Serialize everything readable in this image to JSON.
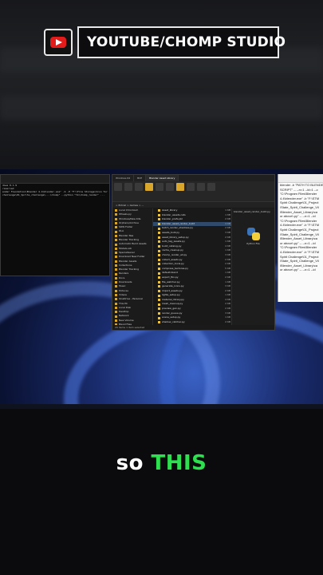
{
  "banner": {
    "text": "YOUTUBE/CHOMP STUDIO",
    "logo_icon": "youtube-play-icon",
    "accent": "#e21b1b"
  },
  "caption": {
    "word1": "so",
    "word2": "THIS",
    "highlight_color": "#2ee04f"
  },
  "terminal": {
    "lines": [
      "dows 0.1.9",
      "reserved",
      "",
      "ender Foundation\\Blender 4.4\\blender.exe\" -b -P \"F:\\File Storage\\Icon for Imported Blend Sp",
      "challenge\\01_Sprite_challenge\\...\\chomp\" --python \"tk\\chomp_render\" ...",
      "",
      "",
      ""
    ]
  },
  "explorer": {
    "tabs": [
      "Windows 64",
      "BCE",
      "Blender Asset Library"
    ],
    "address": "> Entrail > Games > ...",
    "nav": [
      "Local Chromium",
      "Wheels-py",
      "Windows/New Kits",
      "Orphans/Archive",
      "SOW Folder",
      "DLA",
      "Blender Nes",
      "Blender Tracking",
      "Automatic Build Assets",
      "Models-Lib",
      "SpecialGener",
      "Download New Folder",
      "Blender Assets",
      "Collections",
      "Blender Tracking",
      "Renders",
      "Docs",
      "Downloads",
      "Music",
      "Pictures",
      "Videos",
      "OneDrive - Personal",
      "This PC",
      "Local Disk",
      "Desktop",
      "Network",
      "New Volume",
      "Blend Files",
      "Game Build",
      "Assets",
      "Stored Files",
      "Blender Files",
      "Stored Work",
      "Game Assets"
    ],
    "files": [
      {
        "name": "Asset_library",
        "size": "1 KB"
      },
      {
        "name": "blender_assets.cats",
        "size": "1 KB"
      },
      {
        "name": "blender_prefs.pkl",
        "size": "2 KB"
      },
      {
        "name": "blender_asset_render_build",
        "size": "4 KB"
      },
      {
        "name": "batch_render_shadows.py",
        "size": "2 KB"
      },
      {
        "name": "assets_bulk.py",
        "size": "3 KB"
      },
      {
        "name": "asset_library_setup.py",
        "size": "2 KB"
      },
      {
        "name": "auto_tag_assets.py",
        "size": "1 KB"
      },
      {
        "name": "build_catalog.py",
        "size": "4 KB"
      },
      {
        "name": "cache_cleanup.py",
        "size": "1 KB"
      },
      {
        "name": "chomp_render_all.py",
        "size": "3 KB"
      },
      {
        "name": "collect_assets.py",
        "size": "2 KB"
      },
      {
        "name": "collection_tools.py",
        "size": "2 KB"
      },
      {
        "name": "compress_textures.py",
        "size": "5 KB"
      },
      {
        "name": "default.blend",
        "size": "1 KB"
      },
      {
        "name": "export_fbx.py",
        "size": "2 KB"
      },
      {
        "name": "file_watcher.py",
        "size": "1 KB"
      },
      {
        "name": "generate_icons.py",
        "size": "3 KB"
      },
      {
        "name": "import_assets.py",
        "size": "2 KB"
      },
      {
        "name": "lights_setup.py",
        "size": "1 KB"
      },
      {
        "name": "material_library.py",
        "size": "4 KB"
      },
      {
        "name": "mesh_cleanup.py",
        "size": "2 KB"
      },
      {
        "name": "preview_gen.py",
        "size": "2 KB"
      },
      {
        "name": "render_queue.py",
        "size": "3 KB"
      },
      {
        "name": "scene_setup.py",
        "size": "1 KB"
      },
      {
        "name": "shadow_catcher.py",
        "size": "2 KB"
      },
      {
        "name": "sprite_sheet.py",
        "size": "3 KB"
      },
      {
        "name": "thumbnail.py",
        "size": "1 KB"
      },
      {
        "name": "uv_tools.py",
        "size": "2 KB"
      }
    ],
    "selected_index": 3,
    "preview_title": "blender_asset_render_build.py",
    "preview_meta": "Python File",
    "status": "29 items  1 item selected"
  },
  "notepad": {
    "lines": [
      "blender -b \"PATH TO BLENDER",
      "SCRIPT\" -- --n=1 --id=1 --c",
      "",
      "\"C:\\Program Files\\Blender",
      "4.4\\blender.exe\" -b \"F:\\STM",
      "Spirit Challenge\\01_Project",
      "\\State_Spirit_Challenge_Vil",
      "\\Blender_Asset_Library\\ca",
      "or above\\.py\" -- --n=1 --id",
      "",
      "\"C:\\Program Files\\Blender",
      "4.4\\blender.exe\" -b \"F:\\STM",
      "Spirit Challenge\\01_Project",
      "\\State_Spirit_Challenge_Vil",
      "\\Blender_Asset_Library\\ca",
      "or above\\.py\" -- --n=1 --id",
      "",
      "\"C:\\Program Files\\Blender",
      "4.4\\blender.exe\" -b \"F:\\STM",
      "Spirit Challenge\\01_Project",
      "\\State_Spirit_Challenge_Vil",
      "\\Blender_Asset_Library\\ca",
      "or above\\.py\" -- --n=1 --id"
    ]
  }
}
